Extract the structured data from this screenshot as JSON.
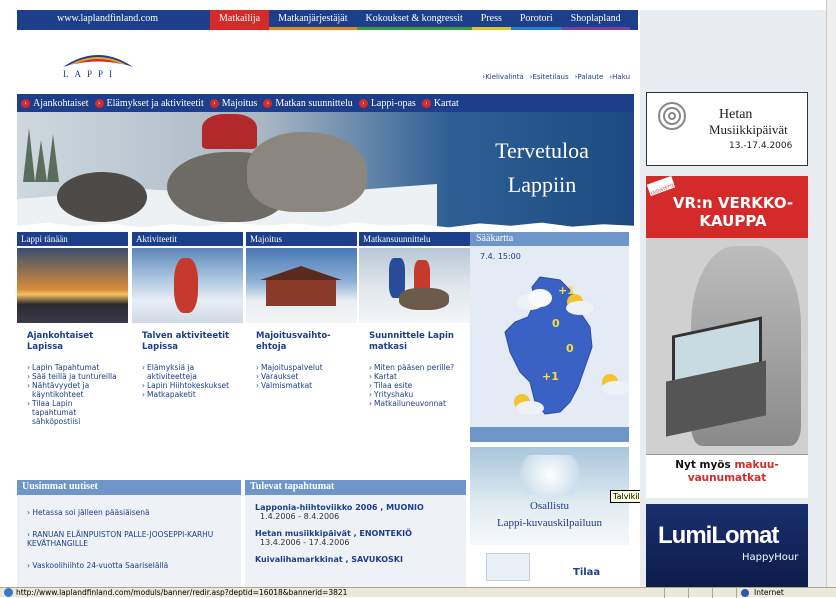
{
  "topbar": {
    "site_url": "www.laplandfinland.com",
    "nav": [
      {
        "label": "Matkailija",
        "color": "#d42a2a"
      },
      {
        "label": "Matkanjärjestäjät",
        "color": "#e08a1e"
      },
      {
        "label": "Kokoukset & kongressit",
        "color": "#3d9d3d"
      },
      {
        "label": "Press",
        "color": "#d9c42a"
      },
      {
        "label": "Porotori",
        "color": "#2a7fc2"
      },
      {
        "label": "Shoplapland",
        "color": "#7b3fa0"
      }
    ]
  },
  "header": {
    "logo_text": "LAPPI",
    "util_links": [
      "Kielivalinta",
      "Esitetilaus",
      "Palaute",
      "Haku"
    ]
  },
  "mainnav": [
    "Ajankohtaiset",
    "Elämykset ja aktiviteetit",
    "Majoitus",
    "Matkan suunnittelu",
    "Lappi-opas",
    "Kartat"
  ],
  "banner": {
    "line1": "Tervetuloa",
    "line2": "Lappiin"
  },
  "columns": [
    {
      "header": "Lappi tänään",
      "title": "Ajankohtaiset Lapissa",
      "links": [
        "Lapin Tapahtumat",
        "Sää teillä ja tuntureilla",
        "Nähtävyydet ja käyntikohteet",
        "Tilaa Lapin tapahtumat sähköpostiisi"
      ]
    },
    {
      "header": "Aktiviteetit",
      "title": "Talven aktiviteetit Lapissa",
      "links": [
        "Elämyksiä ja aktiviteetteja",
        "Lapin Hiihtokeskukset",
        "Matkapaketit"
      ]
    },
    {
      "header": "Majoitus",
      "title": "Majoitusvaihto- ehtoja",
      "links": [
        "Majoituspalvelut",
        "Varaukset",
        "Valmismatkat"
      ]
    },
    {
      "header": "Matkansuunnittelu",
      "title": "Suunnittele Lapin matkasi",
      "links": [
        "Miten pääsen perille?",
        "Kartat",
        "Tilaa esite",
        "Yrityshaku",
        "Matkailuneuvonnat"
      ]
    }
  ],
  "weather": {
    "header": "Sääkartta",
    "time": "7.4. 15:00",
    "temps": [
      "+1",
      "0",
      "0",
      "+1"
    ]
  },
  "kuva": {
    "line1": "Osallistu",
    "line2": "Lappi-kuvauskilpailuun",
    "tooltip": "Talvikilpailu"
  },
  "tilaa": {
    "label": "Tilaa"
  },
  "news": {
    "header": "Uusimmat uutiset",
    "items": [
      "Hetassa soi jälleen pääsiäisenä",
      "RANUAN ELÄINPUISTON PALLE-JOOSEPPI-KARHU KEVÄTHANGILLE",
      "Vaskoolihiihto 24-vuotta Saariselällä"
    ]
  },
  "events": {
    "header": "Tulevat tapahtumat",
    "items": [
      {
        "title": "Lapponia-hiihtoviikko 2006 , MUONIO",
        "date": "1.4.2006 - 8.4.2006"
      },
      {
        "title": "Hetan musiikkipäivät , ENONTEKIÖ",
        "date": "13.4.2006 - 17.4.2006"
      },
      {
        "title": "Kuivalihamarkkinat , SAVUKOSKI",
        "date": ""
      }
    ]
  },
  "ads": {
    "hetan": {
      "line1": "Hetan",
      "line2": "Musiikkipäivät",
      "dates": "13.-17.4.2006"
    },
    "vr": {
      "badge": "UUDISTETTU",
      "title": "VR:n VERKKO- KAUPPA",
      "bottom_a": "Nyt myös ",
      "bottom_b": "makuu-",
      "bottom_c": "vaunumatkat"
    },
    "lumi": {
      "brand": "LumiLomat",
      "sub": "HappyHour"
    }
  },
  "statusbar": {
    "url": "http://www.laplandfinland.com/moduls/banner/redir.asp?deptid=16018&bannerid=3821",
    "zone": "Internet"
  }
}
